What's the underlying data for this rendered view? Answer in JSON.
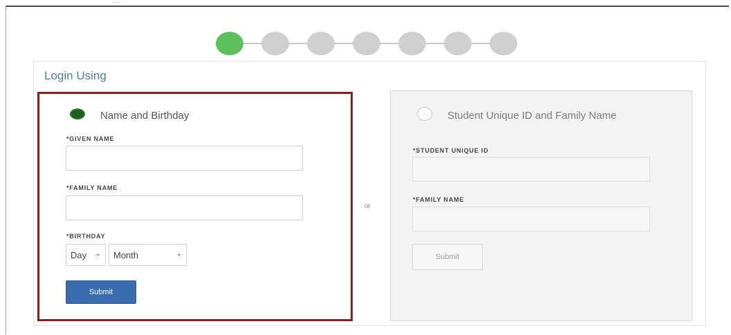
{
  "header": {
    "top_mark": "..."
  },
  "stepper": {
    "total_steps": 7,
    "active_step": 1,
    "active_color": "#5cc15c",
    "inactive_color": "#cfcfcf"
  },
  "login": {
    "title": "Login Using",
    "separator": "or",
    "option_name_birthday": {
      "label": "Name and Birthday",
      "selected": true,
      "given_name_label": "*GIVEN NAME",
      "given_name_value": "",
      "family_name_label": "*FAMILY NAME",
      "family_name_value": "",
      "birthday_label": "*BIRTHDAY",
      "day_select": "Day",
      "month_select": "Month",
      "submit_label": "Submit",
      "submit_color": "#3a6db0",
      "highlight_border_color": "#8f1d1d"
    },
    "option_student_id": {
      "label": "Student Unique ID and Family Name",
      "selected": false,
      "student_id_label": "*STUDENT UNIQUE ID",
      "student_id_value": "",
      "family_name_label": "*FAMILY NAME",
      "family_name_value": "",
      "submit_label": "Submit",
      "disabled": true
    }
  },
  "icons": {
    "radio_checked": "radio-checked-icon",
    "radio_unchecked": "radio-unchecked-icon",
    "chevron": "chevron-down-icon"
  }
}
